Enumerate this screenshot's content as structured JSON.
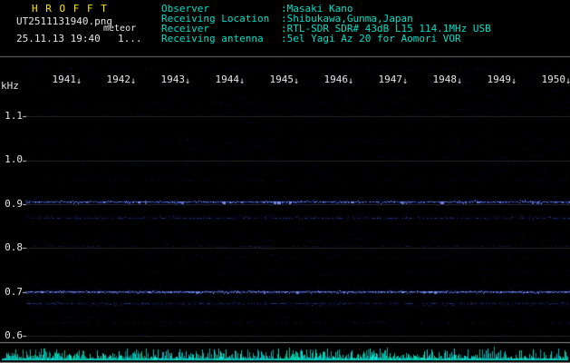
{
  "colors": {
    "background": "#000000",
    "title_yellow": "#ffe400",
    "white_text": "#e6e6e6",
    "meta_cyan": "#00e0c8",
    "band_blue": "#3c5cff",
    "level_strip_cyan": "#00dcc6",
    "grid_line": "#555555"
  },
  "header": {
    "app_title": "H R O F F T",
    "filename": "UT2511131940.png",
    "mode_label": "meteor",
    "datetime": "25.11.13 19:40",
    "counter": "1...",
    "meta": [
      {
        "label": "Observer",
        "value": ":Masaki Kano"
      },
      {
        "label": "Receiving Location",
        "value": ":Shibukawa,Gunma,Japan"
      },
      {
        "label": "Receiver",
        "value": ":RTL-SDR SDR# 43dB L15 114.1MHz USB"
      },
      {
        "label": "Receiving antenna",
        "value": ":5el Yagi Az 20 for Aomori VOR"
      }
    ]
  },
  "chart_data": {
    "type": "heatmap",
    "title": "",
    "xlabel": "",
    "ylabel": "kHz",
    "y_ticks": [
      "1.1",
      "1.0",
      "0.9",
      "0.8",
      "0.7",
      "0.6"
    ],
    "y_range_khz": [
      0.588,
      1.235
    ],
    "x_ticks": [
      "1941",
      "1942",
      "1943",
      "1944",
      "1945",
      "1946",
      "1947",
      "1948",
      "1949",
      "1950"
    ],
    "x_tick_arrow": "↓",
    "grid": true,
    "legend": false,
    "bands": [
      {
        "khz": 1.21,
        "strength": 0.12
      },
      {
        "khz": 1.13,
        "strength": 0.1
      },
      {
        "khz": 1.045,
        "strength": 0.1
      },
      {
        "khz": 0.99,
        "strength": 0.14
      },
      {
        "khz": 0.955,
        "strength": 0.12
      },
      {
        "khz": 0.905,
        "strength": 0.95
      },
      {
        "khz": 0.869,
        "strength": 0.5
      },
      {
        "khz": 0.805,
        "strength": 0.28
      },
      {
        "khz": 0.78,
        "strength": 0.15
      },
      {
        "khz": 0.7,
        "strength": 0.95
      },
      {
        "khz": 0.673,
        "strength": 0.5
      },
      {
        "khz": 0.63,
        "strength": 0.22
      }
    ],
    "level_strip": {
      "present": true,
      "color": "#00dcc6"
    }
  }
}
